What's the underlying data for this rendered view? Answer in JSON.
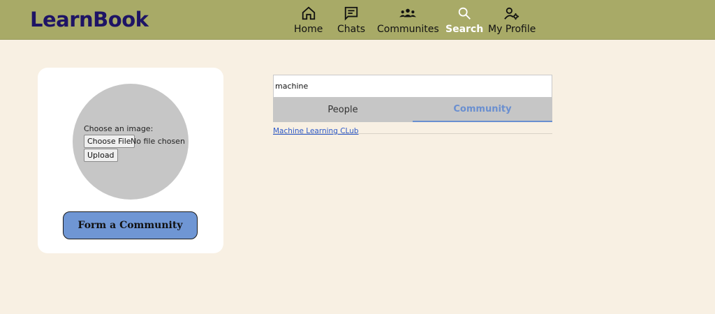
{
  "header": {
    "logo": "LearnBook",
    "nav": [
      {
        "label": "Home",
        "icon": "home-icon"
      },
      {
        "label": "Chats",
        "icon": "chat-icon"
      },
      {
        "label": "Communites",
        "icon": "community-icon"
      },
      {
        "label": "Search",
        "icon": "search-icon",
        "active": true
      },
      {
        "label": "My Profile",
        "icon": "profile-settings-icon"
      }
    ]
  },
  "create_panel": {
    "choose_label": "Choose an image:",
    "choose_file_button": "Choose File",
    "file_status": "No file chosen",
    "upload_button": "Upload",
    "form_button": "Form a Community"
  },
  "search": {
    "query": "machine",
    "tabs": [
      {
        "label": "People",
        "active": false
      },
      {
        "label": "Community",
        "active": true
      }
    ],
    "results": [
      "Machine Learning CLub"
    ]
  },
  "colors": {
    "header_bg": "#a8aa67",
    "page_bg": "#f8f0e3",
    "logo": "#1e1465",
    "accent": "#6f96d4",
    "tab_active": "#6a8fd0"
  }
}
